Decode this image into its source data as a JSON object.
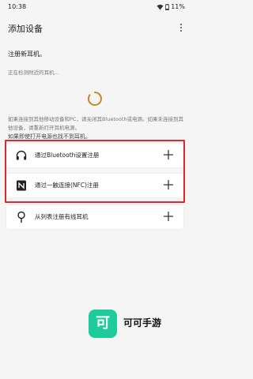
{
  "status_bar": {
    "time": "10:38",
    "battery": "11%"
  },
  "app_bar": {
    "title": "添加设备"
  },
  "main": {
    "section_title": "注册新耳机。",
    "detecting_text": "正在检测附近的耳机...",
    "info_text": "如果连接到其他移动设备和PC，请关闭其Bluetooth或电源。如果未连接到其他设备，请重新打开耳机电源。",
    "not_found_text": "如果即使打开电源也找不到耳机。",
    "options": [
      {
        "label": "通过Bluetooth设置注册",
        "icon": "headphones-icon"
      },
      {
        "label": "通过一触连接(NFC)注册",
        "icon": "nfc-icon"
      },
      {
        "label": "从列表注册有线耳机",
        "icon": "wired-earbuds-icon"
      }
    ]
  },
  "watermark": {
    "logo_char": "可",
    "text": "可可手游"
  },
  "colors": {
    "highlight": "#e0262f",
    "spinner": "#c58a2b",
    "watermark": "#1ecb9b"
  }
}
